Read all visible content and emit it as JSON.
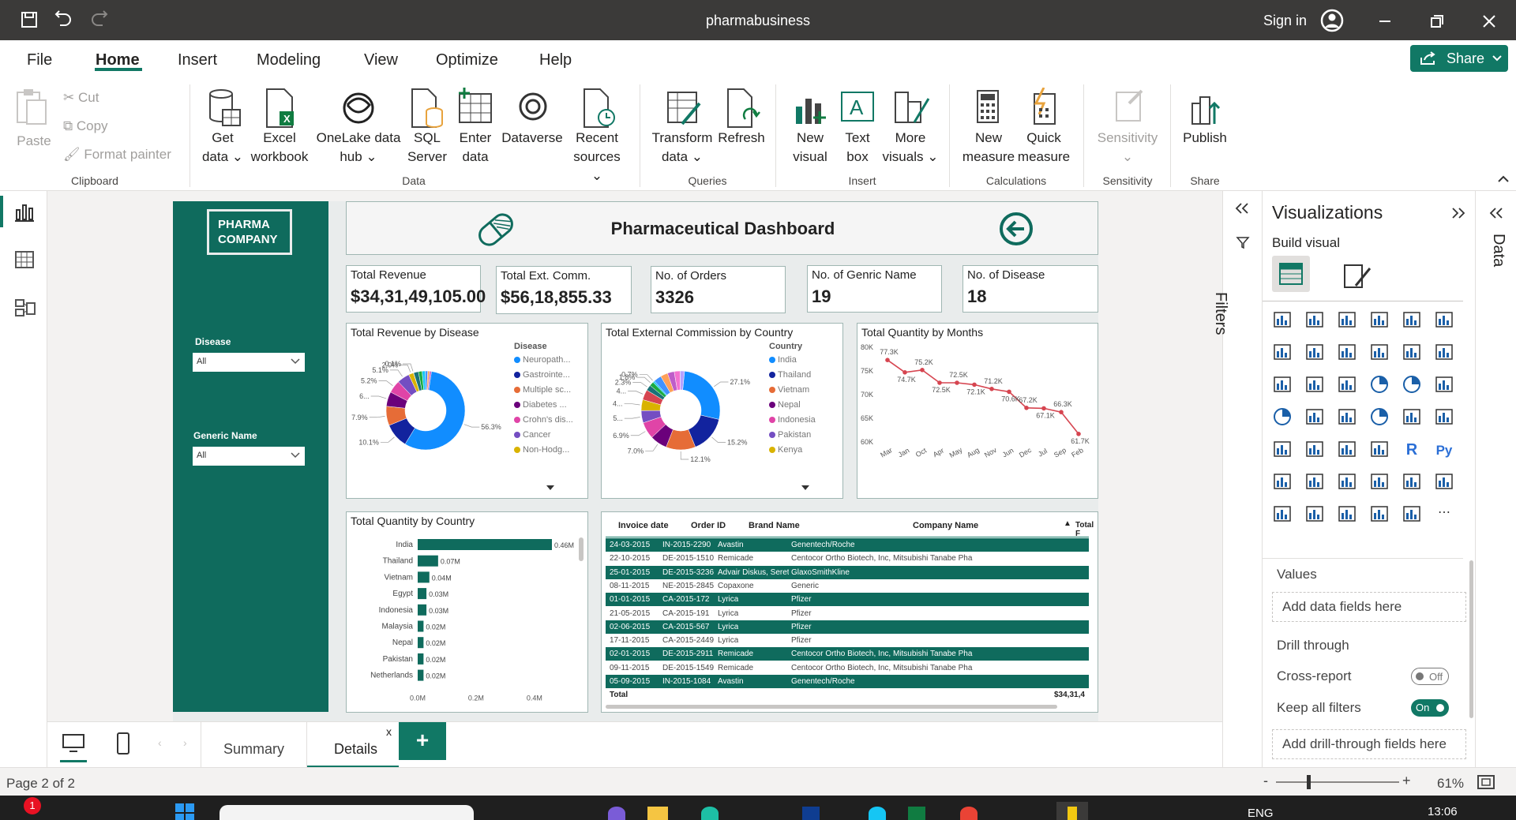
{
  "window": {
    "title": "pharmabusiness",
    "sign_in": "Sign in"
  },
  "menu": [
    "File",
    "Home",
    "Insert",
    "Modeling",
    "View",
    "Optimize",
    "Help"
  ],
  "share_label": "Share",
  "ribbon": {
    "clipboard": {
      "paste": "Paste",
      "cut": "Cut",
      "copy": "Copy",
      "format_painter": "Format painter",
      "group": "Clipboard"
    },
    "data": {
      "get_data": [
        "Get",
        "data ⌄"
      ],
      "excel": [
        "Excel",
        "workbook"
      ],
      "onelake": [
        "OneLake data",
        "hub ⌄"
      ],
      "sql": [
        "SQL",
        "Server"
      ],
      "enter": [
        "Enter",
        "data"
      ],
      "dataverse": "Dataverse",
      "recent": [
        "Recent",
        "sources ⌄"
      ],
      "group": "Data"
    },
    "queries": {
      "transform": [
        "Transform",
        "data ⌄"
      ],
      "refresh": "Refresh",
      "group": "Queries"
    },
    "insert": {
      "new_visual": [
        "New",
        "visual"
      ],
      "text_box": [
        "Text",
        "box"
      ],
      "more_visuals": [
        "More",
        "visuals ⌄"
      ],
      "group": "Insert"
    },
    "calculations": {
      "new_measure": [
        "New",
        "measure"
      ],
      "quick_measure": [
        "Quick",
        "measure"
      ],
      "group": "Calculations"
    },
    "sensitivity": {
      "label": "Sensitivity",
      "group": "Sensitivity"
    },
    "share": {
      "publish": "Publish",
      "group": "Share"
    }
  },
  "report": {
    "logo": [
      "PHARMA",
      "COMPANY"
    ],
    "title": "Pharmaceutical Dashboard",
    "slicers": [
      {
        "label": "Disease",
        "value": "All"
      },
      {
        "label": "Generic Name",
        "value": "All"
      }
    ],
    "kpis": [
      {
        "label": "Total Revenue",
        "value": "$34,31,49,105.00"
      },
      {
        "label": "Total Ext. Comm.",
        "value": "$56,18,855.33"
      },
      {
        "label": "No. of Orders",
        "value": "3326"
      },
      {
        "label": "No. of Genric Name",
        "value": "19"
      },
      {
        "label": "No. of Disease",
        "value": "18"
      }
    ]
  },
  "chart_data": [
    {
      "type": "pie",
      "title": "Total Revenue by Disease",
      "legend_title": "Disease",
      "legend": [
        "Neuropath...",
        "Gastrointe...",
        "Multiple sc...",
        "Diabetes ...",
        "Crohn's dis...",
        "Cancer",
        "Non-Hodg..."
      ],
      "labels": [
        "56.3%",
        "10.1%",
        "7.9%",
        "6...",
        "5.2%",
        "5.1%",
        "2.0%",
        "0.1%"
      ],
      "values": [
        56.3,
        10.1,
        7.9,
        6.0,
        5.2,
        5.1,
        2.0,
        0.1,
        2.0,
        1.5,
        1.3,
        1.0,
        0.8,
        0.7
      ],
      "colors": [
        "#118dff",
        "#12239e",
        "#e66c37",
        "#6b007b",
        "#e044a7",
        "#744ec2",
        "#d9b300",
        "#d64550",
        "#197278",
        "#1aab40",
        "#15c6f4",
        "#4092ff",
        "#ffa058",
        "#be5dc9"
      ]
    },
    {
      "type": "pie",
      "title": "Total External Commission by Country",
      "legend_title": "Country",
      "legend": [
        "India",
        "Thailand",
        "Vietnam",
        "Nepal",
        "Indonesia",
        "Pakistan",
        "Kenya"
      ],
      "labels": [
        "27.1%",
        "15.2%",
        "12.1%",
        "7.0%",
        "6.9%",
        "5...",
        "4...",
        "4...",
        "2.3%",
        "1.8%",
        "0.7%"
      ],
      "values": [
        27.1,
        15.2,
        12.1,
        7.0,
        6.9,
        5.0,
        4.5,
        4.2,
        2.3,
        1.8,
        0.7,
        3.2,
        3.0,
        2.8,
        2.4,
        1.8
      ],
      "colors": [
        "#118dff",
        "#12239e",
        "#e66c37",
        "#6b007b",
        "#e044a7",
        "#744ec2",
        "#d9b300",
        "#d64550",
        "#197278",
        "#1aab40",
        "#15c6f4",
        "#4092ff",
        "#ffa058",
        "#be5dc9",
        "#f472d0",
        "#b5a1ff"
      ]
    },
    {
      "type": "line",
      "title": "Total Quantity by Months",
      "categories": [
        "Mar",
        "Jan",
        "Oct",
        "Apr",
        "May",
        "Aug",
        "Nov",
        "Jun",
        "Dec",
        "Jul",
        "Sep",
        "Feb"
      ],
      "values": [
        77.3,
        74.7,
        75.2,
        72.5,
        72.5,
        72.1,
        71.2,
        70.6,
        67.2,
        67.1,
        66.3,
        61.7
      ],
      "labels": [
        "77.3K",
        "74.7K",
        "75.2K",
        "72.5K",
        "72.5K",
        "72.1K",
        "71.2K",
        "70.6K",
        "67.2K",
        "67.1K",
        "66.3K",
        "61.7K"
      ],
      "yticks": [
        "80K",
        "75K",
        "70K",
        "65K",
        "60K"
      ],
      "ylim": [
        60,
        80
      ],
      "color": "#d64550"
    },
    {
      "type": "bar",
      "title": "Total Quantity by Country",
      "categories": [
        "India",
        "Thailand",
        "Vietnam",
        "Egypt",
        "Indonesia",
        "Malaysia",
        "Nepal",
        "Pakistan",
        "Netherlands"
      ],
      "values": [
        0.46,
        0.07,
        0.04,
        0.03,
        0.03,
        0.02,
        0.02,
        0.02,
        0.02
      ],
      "labels": [
        "0.46M",
        "0.07M",
        "0.04M",
        "0.03M",
        "0.03M",
        "0.02M",
        "0.02M",
        "0.02M",
        "0.02M"
      ],
      "xticks": [
        "0.0M",
        "0.2M",
        "0.4M"
      ],
      "xlim": [
        0,
        0.46
      ],
      "color": "#0f6b5d"
    }
  ],
  "table": {
    "headers": [
      "Invoice date",
      "Order ID",
      "Brand Name",
      "Company Name",
      "Total F"
    ],
    "rows": [
      [
        "24-03-2015",
        "IN-2015-2290",
        "Avastin",
        "Genentech/Roche"
      ],
      [
        "22-10-2015",
        "DE-2015-1510",
        "Remicade",
        "Centocor Ortho Biotech, Inc, Mitsubishi Tanabe Pharma"
      ],
      [
        "25-01-2015",
        "DE-2015-3236",
        "Advair Diskus, Seretide",
        "GlaxoSmithKline"
      ],
      [
        "08-11-2015",
        "NE-2015-2845",
        "Copaxone",
        "Generic"
      ],
      [
        "01-01-2015",
        "CA-2015-172",
        "Lyrica",
        "Pfizer"
      ],
      [
        "21-05-2015",
        "CA-2015-191",
        "Lyrica",
        "Pfizer"
      ],
      [
        "02-06-2015",
        "CA-2015-567",
        "Lyrica",
        "Pfizer"
      ],
      [
        "17-11-2015",
        "CA-2015-2449",
        "Lyrica",
        "Pfizer"
      ],
      [
        "02-01-2015",
        "DE-2015-2911",
        "Remicade",
        "Centocor Ortho Biotech, Inc, Mitsubishi Tanabe Pharma"
      ],
      [
        "09-11-2015",
        "DE-2015-1549",
        "Remicade",
        "Centocor Ortho Biotech, Inc, Mitsubishi Tanabe Pharma"
      ],
      [
        "05-09-2015",
        "IN-2015-1084",
        "Avastin",
        "Genentech/Roche"
      ]
    ],
    "total_label": "Total",
    "total_value": "$34,31,4"
  },
  "filters_label": "Filters",
  "visualizations": {
    "title": "Visualizations",
    "build": "Build visual",
    "values": "Values",
    "add_fields": "Add data fields here",
    "drill": "Drill through",
    "cross_report": "Cross-report",
    "cross_state": "Off",
    "keep_filters": "Keep all filters",
    "keep_state": "On",
    "add_drill": "Add drill-through fields here",
    "r_label": "R",
    "py_label": "Py"
  },
  "data_label": "Data",
  "tabs": {
    "summary": "Summary",
    "details": "Details",
    "close": "x",
    "add": "+"
  },
  "status": {
    "page": "Page 2 of 2",
    "zoom": "61%",
    "minus": "-",
    "plus": "+"
  },
  "taskbar": {
    "lang": "ENG",
    "time": "13:06",
    "badge": "1"
  },
  "colors": {
    "accent": "#117865",
    "report_teal": "#0f6b5d",
    "titlebar": "#3b3a39"
  }
}
